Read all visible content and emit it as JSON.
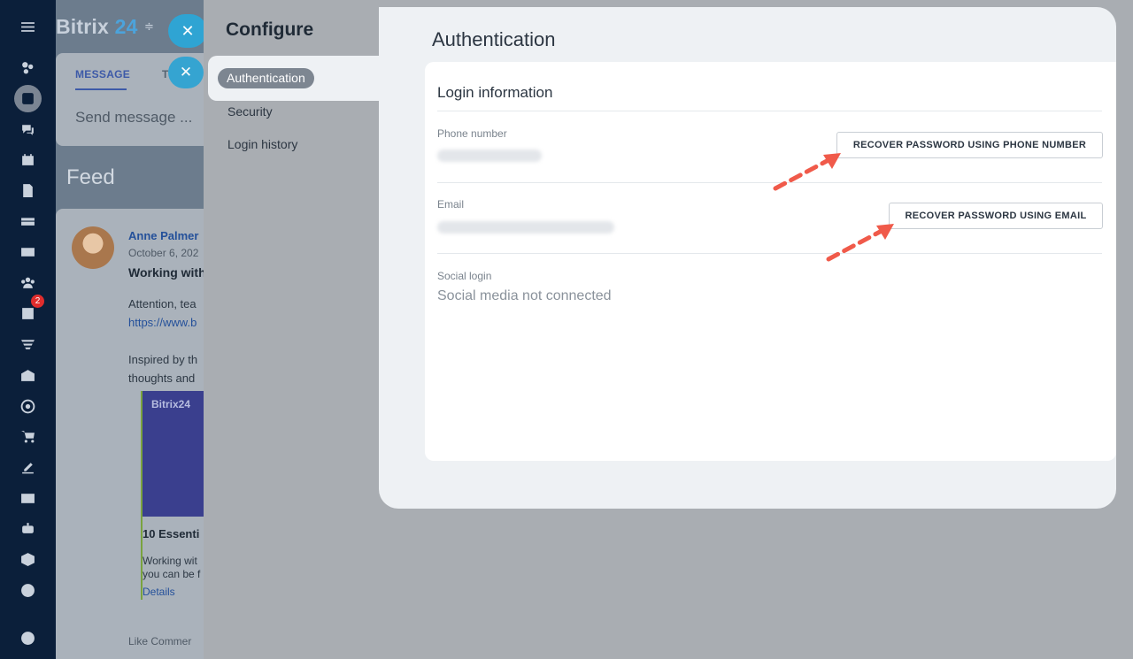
{
  "brand": {
    "name": "Bitrix",
    "number": "24"
  },
  "composer": {
    "tab_message": "MESSAGE",
    "tab_other": "T",
    "placeholder": "Send message ..."
  },
  "feed": {
    "title": "Feed"
  },
  "post": {
    "author": "Anne Palmer",
    "date": "October 6, 202",
    "title": "Working with",
    "line1": "Attention, tea",
    "link": "https://www.b",
    "line2": "Inspired by th",
    "line3": "thoughts and",
    "card_brand": "Bitrix24",
    "card_title": "10 Essenti",
    "card_line1": "Working wit",
    "card_line2": "you can be f",
    "card_details": "Details",
    "actions": "Like   Commer"
  },
  "rail": {
    "tasks_badge": "2"
  },
  "configure": {
    "title": "Configure",
    "menu": [
      "Authentication",
      "Security",
      "Login history"
    ]
  },
  "auth": {
    "title": "Authentication",
    "card_title": "Login information",
    "phone_label": "Phone number",
    "phone_button": "RECOVER PASSWORD USING PHONE NUMBER",
    "email_label": "Email",
    "email_button": "RECOVER PASSWORD USING EMAIL",
    "social_label": "Social login",
    "social_value": "Social media not connected"
  },
  "colors": {
    "accent": "#2fa4d3",
    "arrow": "#f05a4a",
    "link": "#24509a"
  }
}
